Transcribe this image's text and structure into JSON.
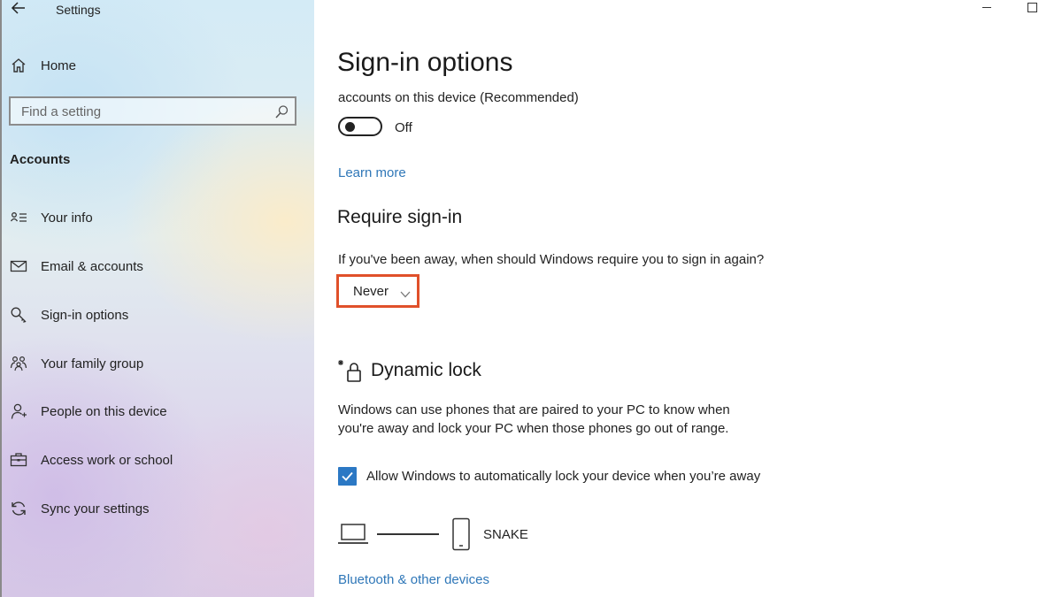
{
  "window": {
    "app_title": "Settings"
  },
  "sidebar": {
    "home_label": "Home",
    "search_placeholder": "Find a setting",
    "section_header": "Accounts",
    "items": [
      {
        "label": "Your info",
        "icon": "contact-card-icon"
      },
      {
        "label": "Email & accounts",
        "icon": "mail-icon"
      },
      {
        "label": "Sign-in options",
        "icon": "key-icon"
      },
      {
        "label": "Your family group",
        "icon": "family-icon"
      },
      {
        "label": "People on this device",
        "icon": "person-icon"
      },
      {
        "label": "Access work or school",
        "icon": "briefcase-icon"
      },
      {
        "label": "Sync your settings",
        "icon": "sync-icon"
      }
    ]
  },
  "main": {
    "page_title": "Sign-in options",
    "partial_text": "accounts on this device (Recommended)",
    "toggle_state": "Off",
    "learn_more": "Learn more",
    "require_signin": {
      "heading": "Require sign-in",
      "question": "If you've been away, when should Windows require you to sign in again?",
      "dropdown_value": "Never"
    },
    "dynamic_lock": {
      "heading": "Dynamic lock",
      "description_line1": "Windows can use phones that are paired to your PC to know when",
      "description_line2": "you're away and lock your PC when those phones go out of range.",
      "checkbox_label": "Allow Windows to automatically lock your device when you’re away",
      "checkbox_checked": true,
      "paired_device": "SNAKE"
    },
    "bluetooth_link": "Bluetooth & other devices"
  },
  "colors": {
    "accent": "#2b78c4",
    "link": "#2f77b8",
    "highlight_box": "#e0502a"
  }
}
